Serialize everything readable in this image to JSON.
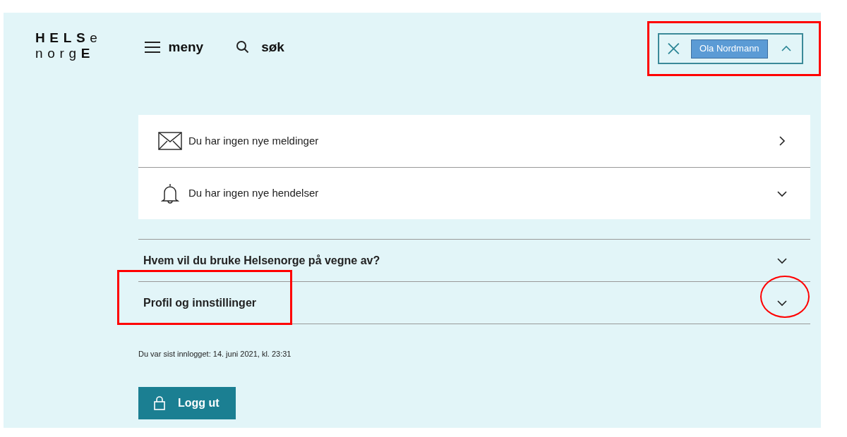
{
  "logo": {
    "line_1": "**HELS**e",
    "line_2": "norg**E**"
  },
  "header": {
    "menu_label": "meny",
    "search_label": "søk"
  },
  "user_menu": {
    "user_name": "Ola Nordmann",
    "expanded": true
  },
  "notifications": [
    {
      "kind": "link",
      "text": "Du har ingen nye meldinger"
    },
    {
      "kind": "expandable",
      "text": "Du har ingen nye hendelser"
    }
  ],
  "accordions": [
    {
      "title": "Hvem vil du bruke Helsenorge på vegne av?",
      "expanded": false
    },
    {
      "title": "Profil og innstillinger",
      "expanded": false
    }
  ],
  "last_login": "Du var sist innlogget: 14. juni 2021, kl. 23:31",
  "logout_button": "Logg ut"
}
